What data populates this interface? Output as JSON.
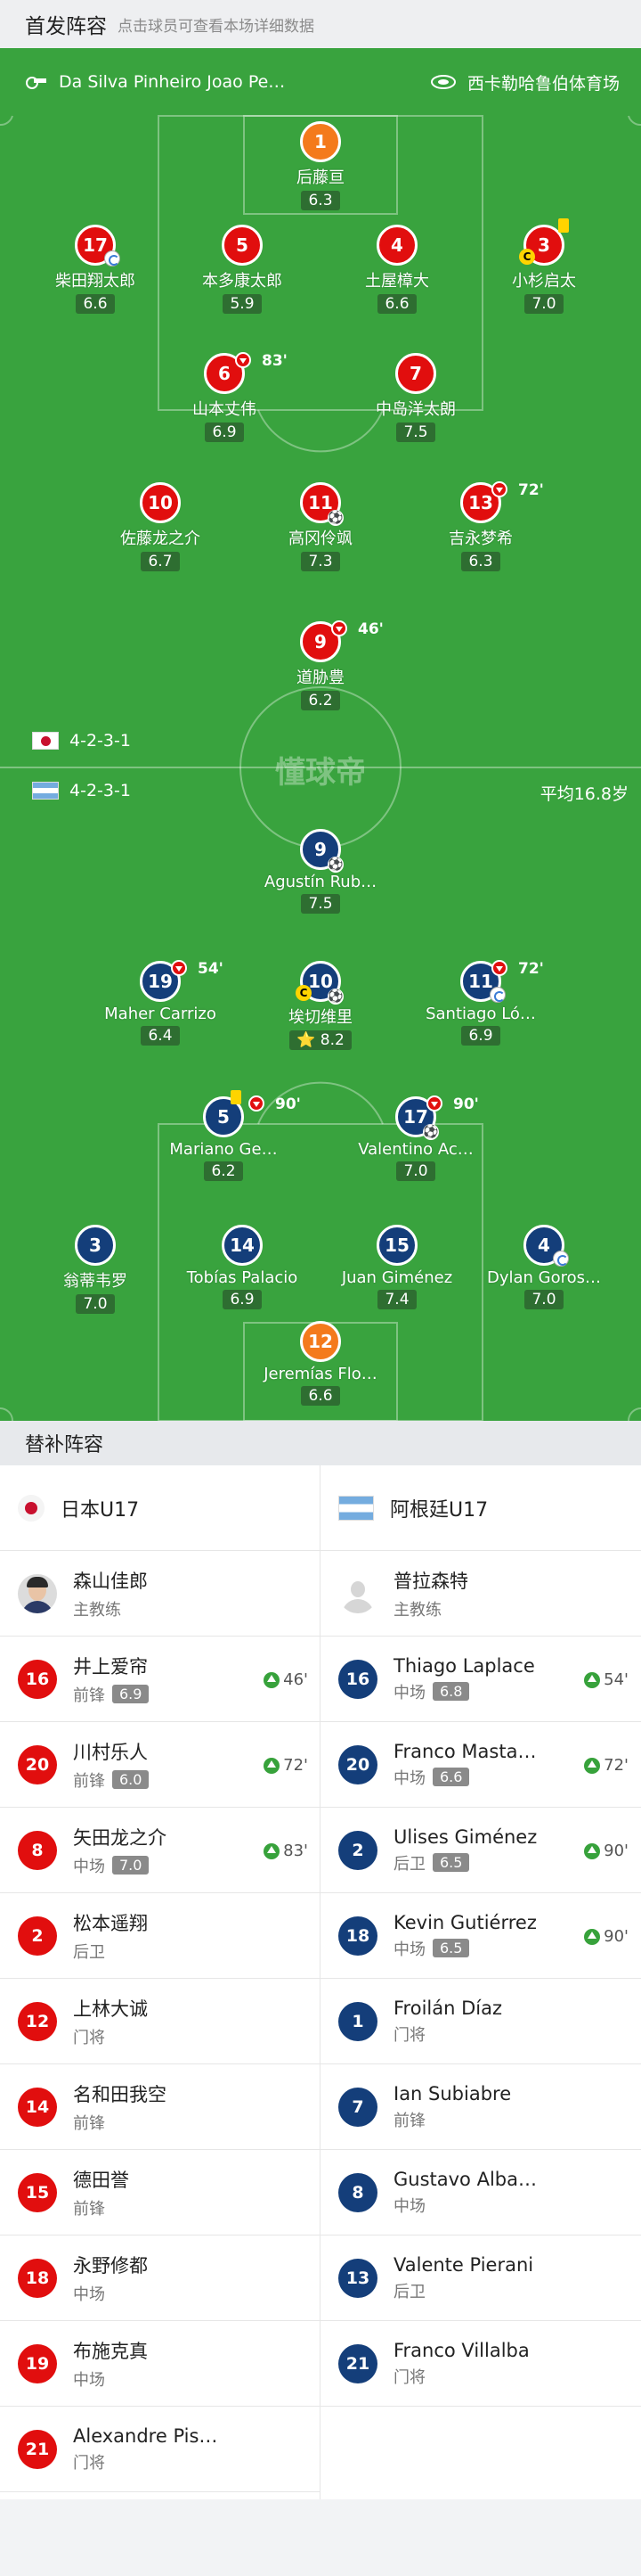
{
  "header": {
    "title": "首发阵容",
    "subtitle": "点击球员可查看本场详细数据"
  },
  "pitch_header": {
    "referee": "Da Silva Pinheiro Joao Pe…",
    "stadium": "西卡勒哈鲁伯体育场"
  },
  "watermark": "懂球帝",
  "home": {
    "formation": "4-2-3-1",
    "players": [
      {
        "no": "1",
        "name": "后藤亘",
        "rating": "6.3"
      },
      {
        "no": "17",
        "name": "柴田翔太郎",
        "rating": "6.6"
      },
      {
        "no": "5",
        "name": "本多康太郎",
        "rating": "5.9"
      },
      {
        "no": "4",
        "name": "土屋樟大",
        "rating": "6.6"
      },
      {
        "no": "3",
        "name": "小杉启太",
        "rating": "7.0"
      },
      {
        "no": "6",
        "name": "山本丈伟",
        "rating": "6.9",
        "sub_time": "83'"
      },
      {
        "no": "7",
        "name": "中岛洋太朗",
        "rating": "7.5"
      },
      {
        "no": "10",
        "name": "佐藤龙之介",
        "rating": "6.7"
      },
      {
        "no": "11",
        "name": "高冈伶飒",
        "rating": "7.3"
      },
      {
        "no": "13",
        "name": "吉永梦希",
        "rating": "6.3",
        "sub_time": "72'"
      },
      {
        "no": "9",
        "name": "道胁豊",
        "rating": "6.2",
        "sub_time": "46'"
      }
    ]
  },
  "away": {
    "formation": "4-2-3-1",
    "avg_age": "平均16.8岁",
    "players": [
      {
        "no": "9",
        "name": "Agustín Rub…",
        "rating": "7.5"
      },
      {
        "no": "19",
        "name": "Maher Carrizo",
        "rating": "6.4",
        "sub_time": "54'"
      },
      {
        "no": "10",
        "name": "埃切维里",
        "rating": "8.2",
        "star": "⭐"
      },
      {
        "no": "11",
        "name": "Santiago Ló…",
        "rating": "6.9",
        "sub_time": "72'"
      },
      {
        "no": "5",
        "name": "Mariano Ge…",
        "rating": "6.2",
        "sub_time": "90'"
      },
      {
        "no": "17",
        "name": "Valentino Ac…",
        "rating": "7.0",
        "sub_time": "90'"
      },
      {
        "no": "3",
        "name": "翁蒂韦罗",
        "rating": "7.0"
      },
      {
        "no": "14",
        "name": "Tobías Palacio",
        "rating": "6.9"
      },
      {
        "no": "15",
        "name": "Juan Giménez",
        "rating": "7.4"
      },
      {
        "no": "4",
        "name": "Dylan Goros…",
        "rating": "7.0"
      },
      {
        "no": "12",
        "name": "Jeremías Flo…",
        "rating": "6.6"
      }
    ]
  },
  "subs": {
    "title": "替补阵容",
    "home": {
      "team": "日本U17",
      "coach": {
        "name": "森山佳郎",
        "role": "主教练"
      },
      "players": [
        {
          "no": "16",
          "name": "井上爱帘",
          "pos": "前锋",
          "rating": "6.9",
          "in": "46'"
        },
        {
          "no": "20",
          "name": "川村乐人",
          "pos": "前锋",
          "rating": "6.0",
          "in": "72'"
        },
        {
          "no": "8",
          "name": "矢田龙之介",
          "pos": "中场",
          "rating": "7.0",
          "in": "83'"
        },
        {
          "no": "2",
          "name": "松本遥翔",
          "pos": "后卫"
        },
        {
          "no": "12",
          "name": "上林大诚",
          "pos": "门将"
        },
        {
          "no": "14",
          "name": "名和田我空",
          "pos": "前锋"
        },
        {
          "no": "15",
          "name": "德田誉",
          "pos": "前锋"
        },
        {
          "no": "18",
          "name": "永野修都",
          "pos": "中场"
        },
        {
          "no": "19",
          "name": "布施克真",
          "pos": "中场"
        },
        {
          "no": "21",
          "name": "Alexandre Pis…",
          "pos": "门将"
        }
      ]
    },
    "away": {
      "team": "阿根廷U17",
      "coach": {
        "name": "普拉森特",
        "role": "主教练"
      },
      "players": [
        {
          "no": "16",
          "name": "Thiago Laplace",
          "pos": "中场",
          "rating": "6.8",
          "in": "54'"
        },
        {
          "no": "20",
          "name": "Franco Masta…",
          "pos": "中场",
          "rating": "6.6",
          "in": "72'"
        },
        {
          "no": "2",
          "name": "Ulises Giménez",
          "pos": "后卫",
          "rating": "6.5",
          "in": "90'"
        },
        {
          "no": "18",
          "name": "Kevin Gutiérrez",
          "pos": "中场",
          "rating": "6.5",
          "in": "90'"
        },
        {
          "no": "1",
          "name": "Froilán Díaz",
          "pos": "门将"
        },
        {
          "no": "7",
          "name": "Ian Subiabre",
          "pos": "前锋"
        },
        {
          "no": "8",
          "name": "Gustavo Alba…",
          "pos": "中场"
        },
        {
          "no": "13",
          "name": "Valente Pierani",
          "pos": "后卫"
        },
        {
          "no": "21",
          "name": "Franco Villalba",
          "pos": "门将"
        }
      ]
    }
  },
  "colors": {
    "pitch": "#39a33e",
    "home": "#e10e0e",
    "away": "#143e7a",
    "keeper": "#f47a1c"
  }
}
